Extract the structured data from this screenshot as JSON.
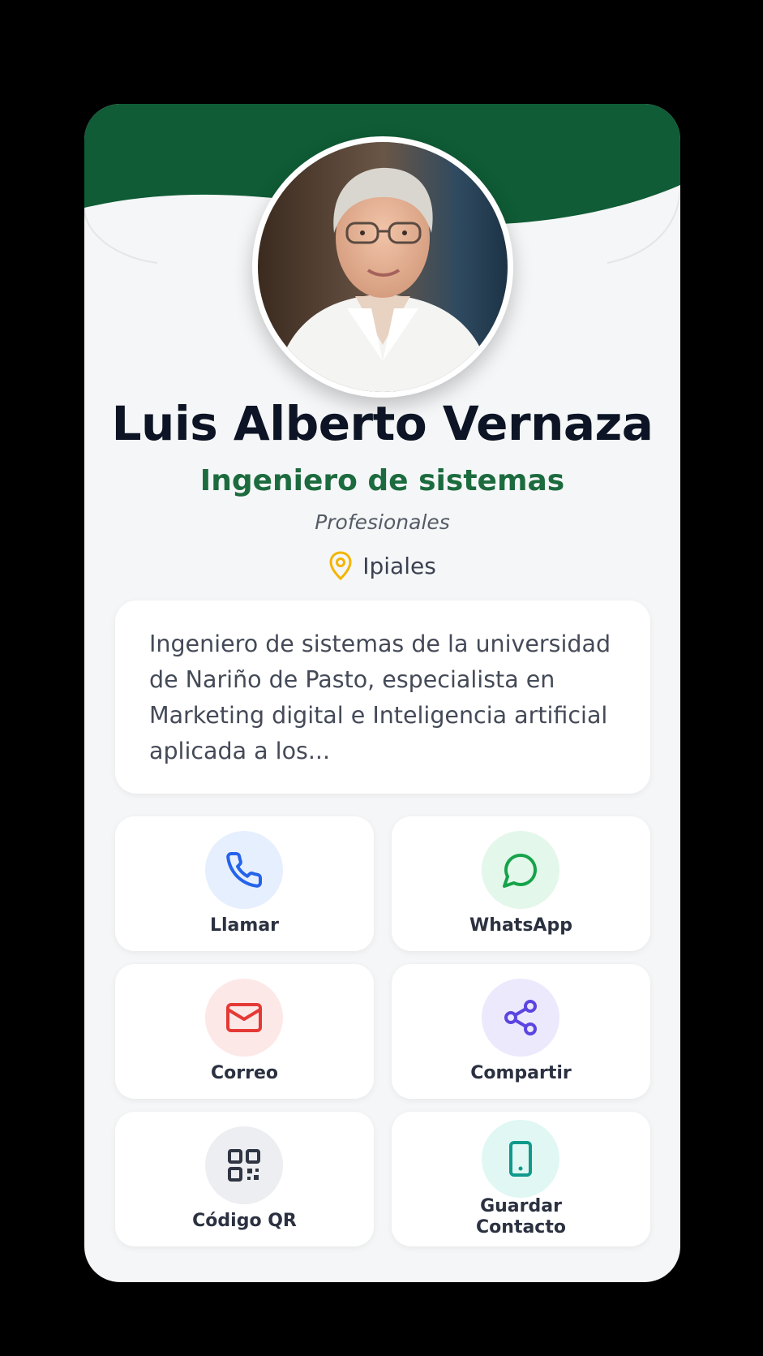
{
  "profile": {
    "name": "Luis Alberto Vernaza",
    "role": "Ingeniero de sistemas",
    "category": "Profesionales",
    "location": "Ipiales",
    "bio": "Ingeniero de sistemas de la universidad de Nariño de Pasto, especialista en Marketing digital e Inteligencia artificial aplicada a los..."
  },
  "actions": {
    "call": {
      "label": "Llamar",
      "icon": "phone-icon",
      "color": "#2563eb",
      "bg": "#e6effd"
    },
    "whatsapp": {
      "label": "WhatsApp",
      "icon": "whatsapp-icon",
      "color": "#16a34a",
      "bg": "#e3f7ea"
    },
    "email": {
      "label": "Correo",
      "icon": "mail-icon",
      "color": "#e53935",
      "bg": "#fde8e8"
    },
    "share": {
      "label": "Compartir",
      "icon": "share-icon",
      "color": "#5b45e0",
      "bg": "#ece9fd"
    },
    "qr": {
      "label": "Código QR",
      "icon": "qr-code-icon",
      "color": "#2f3542",
      "bg": "#eceef1"
    },
    "save": {
      "label_line1": "Guardar",
      "label_line2": "Contacto",
      "icon": "smartphone-icon",
      "color": "#0f9a8c",
      "bg": "#e0f7f3"
    }
  },
  "colors": {
    "header_green": "#0f5c36",
    "role_green": "#1c6b3f",
    "pin_yellow": "#f4b400"
  }
}
